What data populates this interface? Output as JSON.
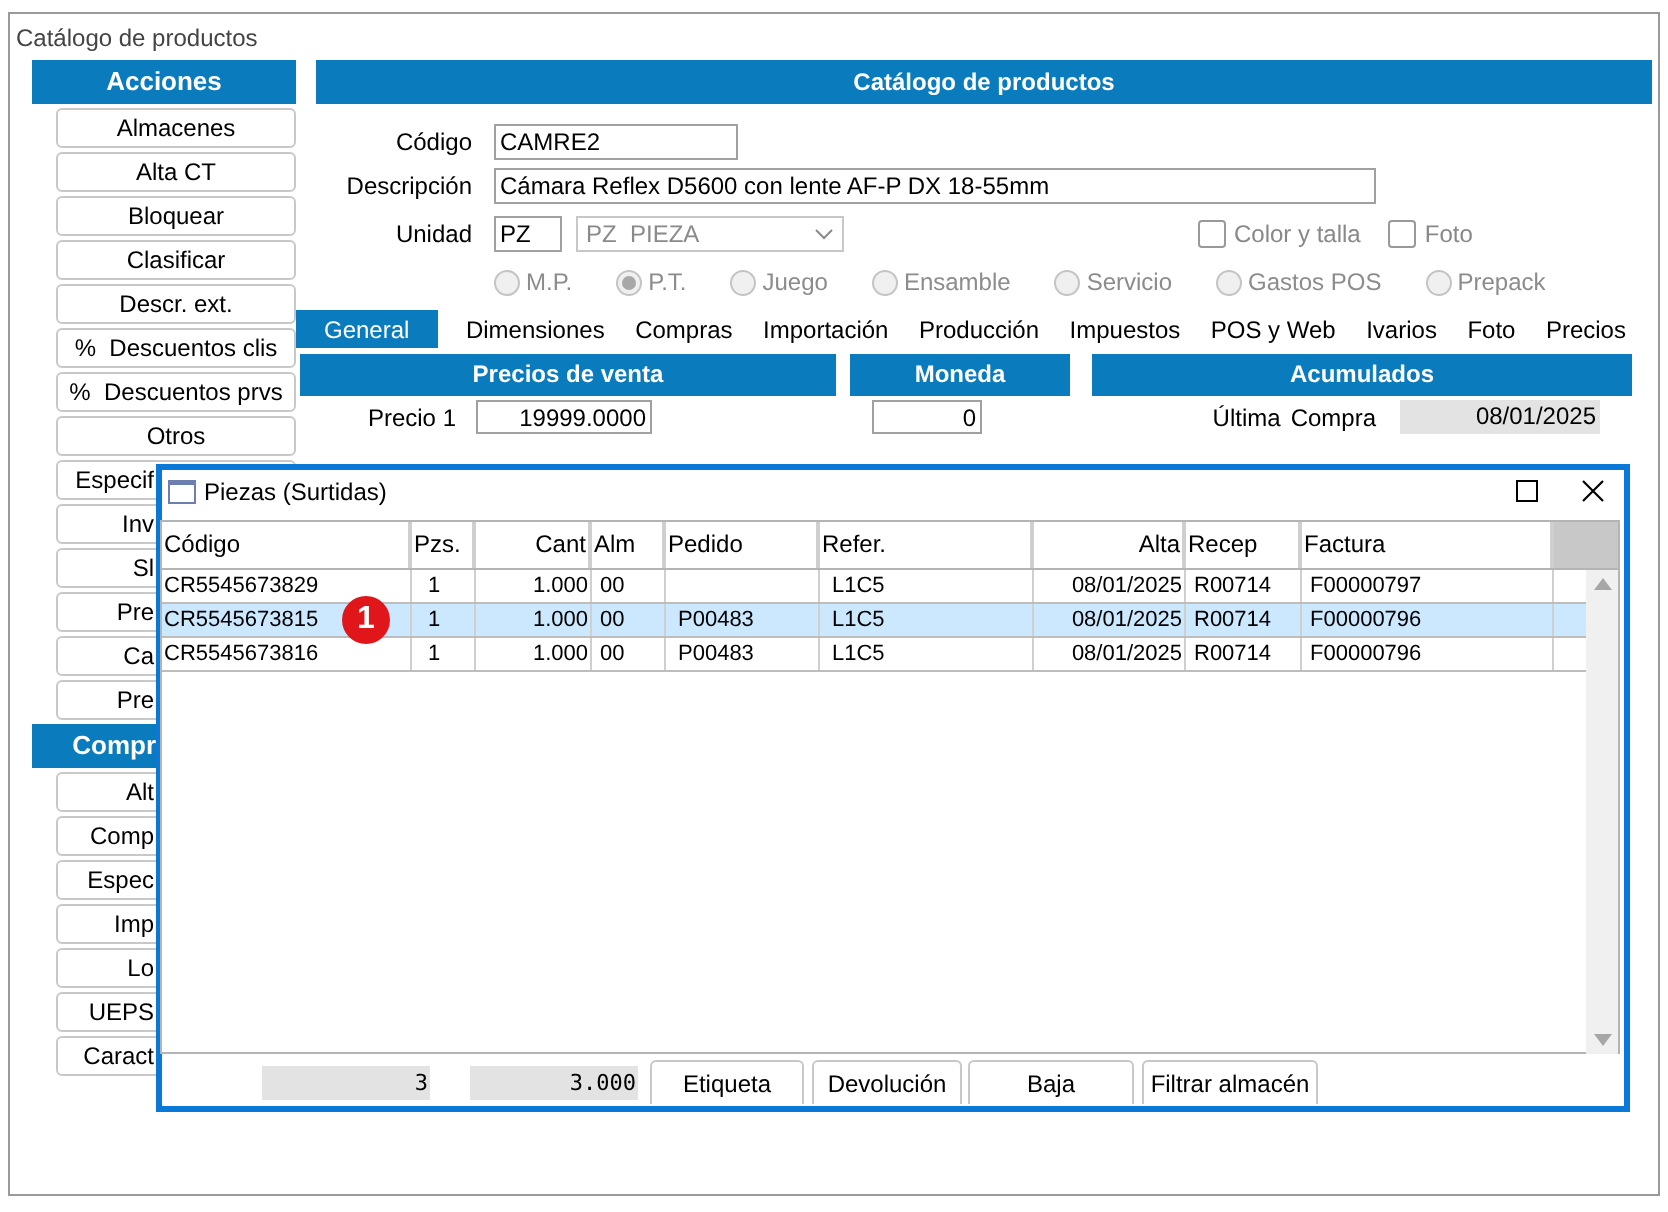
{
  "window": {
    "title": "Catálogo de productos"
  },
  "sidebar": [
    {
      "title": "Acciones",
      "buttons": [
        "Almacenes",
        "Alta CT",
        "Bloquear",
        "Clasificar",
        "Descr. ext.",
        "%  Descuentos clis",
        "%  Descuentos prvs",
        "Otros",
        "Especif",
        "Inv",
        "Sl",
        "Pre",
        "Ca",
        "Pre"
      ]
    },
    {
      "title": "Compr",
      "buttons": [
        "Alt",
        "Comp",
        "Espec",
        "Imp",
        "Lo",
        "UEPS",
        "Caract"
      ]
    }
  ],
  "header": {
    "title": "Catálogo de productos"
  },
  "form": {
    "fields": [
      {
        "label": "Código",
        "value": "CAMRE2"
      },
      {
        "label": "Descripción",
        "value": "Cámara Reflex D5600 con lente AF-P DX 18-55mm"
      }
    ],
    "unit": {
      "label": "Unidad",
      "value": "PZ",
      "dropdown": "PZ  PIEZA"
    },
    "checkboxes": [
      {
        "label": "Color y talla",
        "checked": false
      },
      {
        "label": "Foto",
        "checked": false
      }
    ],
    "radios": [
      {
        "label": "M.P.",
        "selected": false
      },
      {
        "label": "P.T.",
        "selected": true
      },
      {
        "label": "Juego",
        "selected": false
      },
      {
        "label": "Ensamble",
        "selected": false
      },
      {
        "label": "Servicio",
        "selected": false
      },
      {
        "label": "Gastos POS",
        "selected": false
      },
      {
        "label": "Prepack",
        "selected": false
      }
    ],
    "radios_disabled": true
  },
  "tabs": [
    {
      "label": "General",
      "selected": true
    },
    {
      "label": "Dimensiones",
      "selected": false
    },
    {
      "label": "Compras",
      "selected": false
    },
    {
      "label": "Importación",
      "selected": false
    },
    {
      "label": "Producción",
      "selected": false
    },
    {
      "label": "Impuestos",
      "selected": false
    },
    {
      "label": "POS y Web",
      "selected": false
    },
    {
      "label": "Ivarios",
      "selected": false
    },
    {
      "label": "Foto",
      "selected": false
    },
    {
      "label": "Precios",
      "selected": false
    }
  ],
  "sections": [
    "Precios de venta",
    "Moneda",
    "Acumulados"
  ],
  "prices": [
    {
      "label": "Precio 1",
      "value": "19999.0000",
      "moneda": "0",
      "acc_label_1": "Última",
      "acc_label_2": "Compra",
      "acc_value": "08/01/2025"
    }
  ],
  "dialog": {
    "title": "Piezas (Surtidas)",
    "columns": [
      "Código",
      "Pzs.",
      "Cant",
      "Alm",
      "Pedido",
      "Refer.",
      "Alta",
      "Recep",
      "Factura"
    ],
    "rows": [
      {
        "selected": false,
        "cells": [
          "CR5545673829",
          "1",
          "1.000",
          "00",
          "",
          "L1C5",
          "08/01/2025",
          "R00714",
          "F00000797"
        ]
      },
      {
        "selected": true,
        "cells": [
          "CR5545673815",
          "1",
          "1.000",
          "00",
          "P00483",
          "L1C5",
          "08/01/2025",
          "R00714",
          "F00000796"
        ]
      },
      {
        "selected": false,
        "cells": [
          "CR5545673816",
          "1",
          "1.000",
          "00",
          "P00483",
          "L1C5",
          "08/01/2025",
          "R00714",
          "F00000796"
        ]
      }
    ],
    "callout": "1",
    "totals": [
      "3",
      "3.000"
    ],
    "buttons": [
      "Etiqueta",
      "Devolución",
      "Baja",
      "Filtrar almacén"
    ]
  }
}
